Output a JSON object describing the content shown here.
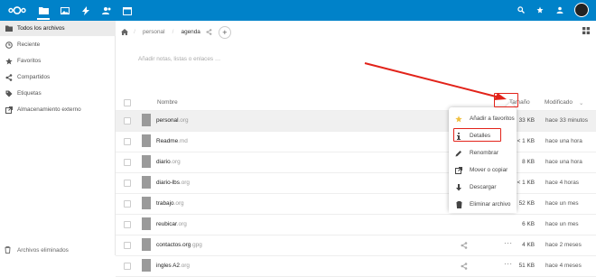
{
  "header": {
    "apps": [
      "files-icon",
      "photos-icon",
      "activity-icon",
      "contacts-icon",
      "calendar-icon"
    ]
  },
  "sidebar": {
    "items": [
      {
        "label": "Todos los archivos",
        "icon": "folder-icon"
      },
      {
        "label": "Reciente",
        "icon": "clock-icon"
      },
      {
        "label": "Favoritos",
        "icon": "star-icon"
      },
      {
        "label": "Compartidos",
        "icon": "share-icon"
      },
      {
        "label": "Etiquetas",
        "icon": "tag-icon"
      },
      {
        "label": "Almacenamiento externo",
        "icon": "external-icon"
      }
    ],
    "bottom": "Archivos eliminados"
  },
  "breadcrumb": {
    "items": [
      "personal",
      "agenda"
    ]
  },
  "description_placeholder": "Añadir notas, listas o enlaces …",
  "table": {
    "col_name": "Nombre",
    "col_size": "Tamaño",
    "col_modified": "Modificado",
    "rows": [
      {
        "name": "personal",
        "ext": ".org",
        "size": "33 KB",
        "modified": "hace 33 minutos"
      },
      {
        "name": "Readme",
        "ext": ".md",
        "size": "< 1 KB",
        "modified": "hace una hora"
      },
      {
        "name": "diario",
        "ext": ".org",
        "size": "8 KB",
        "modified": "hace una hora"
      },
      {
        "name": "diario-lbs",
        "ext": ".org",
        "size": "< 1 KB",
        "modified": "hace 4 horas"
      },
      {
        "name": "trabajo",
        "ext": ".org",
        "size": "52 KB",
        "modified": "hace un mes"
      },
      {
        "name": "reubicar",
        "ext": ".org",
        "size": "6 KB",
        "modified": "hace un mes"
      },
      {
        "name": "contactos.org",
        "ext": ".gpg",
        "size": "4 KB",
        "modified": "hace 2 meses"
      },
      {
        "name": "ingles A2",
        "ext": ".org",
        "size": "51 KB",
        "modified": "hace 4 meses"
      }
    ]
  },
  "menu": {
    "items": [
      {
        "label": "Añadir a favoritos",
        "icon": "star-icon"
      },
      {
        "label": "Detalles",
        "icon": "info-icon"
      },
      {
        "label": "Renombrar",
        "icon": "pencil-icon"
      },
      {
        "label": "Mover o copiar",
        "icon": "external-icon"
      },
      {
        "label": "Descargar",
        "icon": "download-icon"
      },
      {
        "label": "Eliminar archivo",
        "icon": "trash-icon"
      }
    ]
  },
  "colors": {
    "header": "#0082c9",
    "annotation": "#e2231a"
  }
}
